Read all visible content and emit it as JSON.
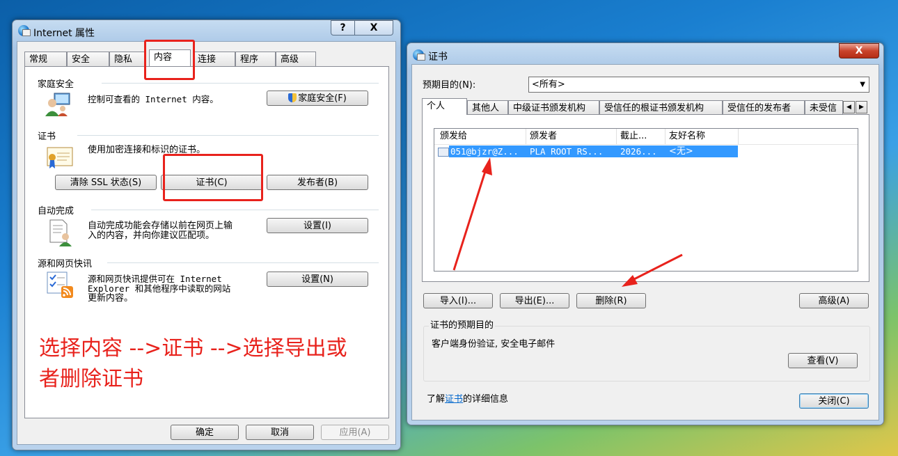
{
  "left_window": {
    "title": "Internet 属性",
    "help_button": "?",
    "close_button": "X",
    "tabs": [
      "常规",
      "安全",
      "隐私",
      "内容",
      "连接",
      "程序",
      "高级"
    ],
    "active_tab": "内容",
    "family": {
      "title": "家庭安全",
      "desc": "控制可查看的 Internet 内容。",
      "button": "家庭安全(F)"
    },
    "cert": {
      "title": "证书",
      "desc": "使用加密连接和标识的证书。",
      "clear_ssl": "清除 SSL 状态(S)",
      "certificates": "证书(C)",
      "publishers": "发布者(B)"
    },
    "autocomplete": {
      "title": "自动完成",
      "desc_line1": "自动完成功能会存储以前在网页上输",
      "desc_line2": "入的内容，并向你建议匹配项。",
      "button": "设置(I)"
    },
    "feeds": {
      "title": "源和网页快讯",
      "desc_line1": "源和网页快讯提供可在 Internet",
      "desc_line2": "Explorer 和其他程序中读取的网站",
      "desc_line3": "更新内容。",
      "button": "设置(N)"
    },
    "annotation_line1": "选择内容 -->证书 -->选择导出或",
    "annotation_line2": "者删除证书",
    "ok": "确定",
    "cancel": "取消",
    "apply": "应用(A)"
  },
  "right_window": {
    "title": "证书",
    "close_button": "X",
    "purpose_label": "预期目的(N):",
    "purpose_value": "<所有>",
    "tabs": [
      "个人",
      "其他人",
      "中级证书颁发机构",
      "受信任的根证书颁发机构",
      "受信任的发布者",
      "未受信"
    ],
    "active_tab": "个人",
    "columns": [
      "颁发给",
      "颁发者",
      "截止...",
      "友好名称"
    ],
    "rows": [
      {
        "issued_to": "051@bjzr@Z...",
        "issued_by": "PLA ROOT RS...",
        "expires": "2026...",
        "friendly": "<无>"
      }
    ],
    "import": "导入(I)...",
    "export": "导出(E)...",
    "remove": "删除(R)",
    "advanced": "高级(A)",
    "purposes_title": "证书的预期目的",
    "purposes_value": "客户端身份验证, 安全电子邮件",
    "view": "查看(V)",
    "learn_prefix": "了解",
    "learn_link": "证书",
    "learn_suffix": "的详细信息",
    "close": "关闭(C)"
  },
  "colors": {
    "annotation_red": "#e8221c",
    "selection_blue": "#3399ff",
    "link_blue": "#0066cc"
  }
}
